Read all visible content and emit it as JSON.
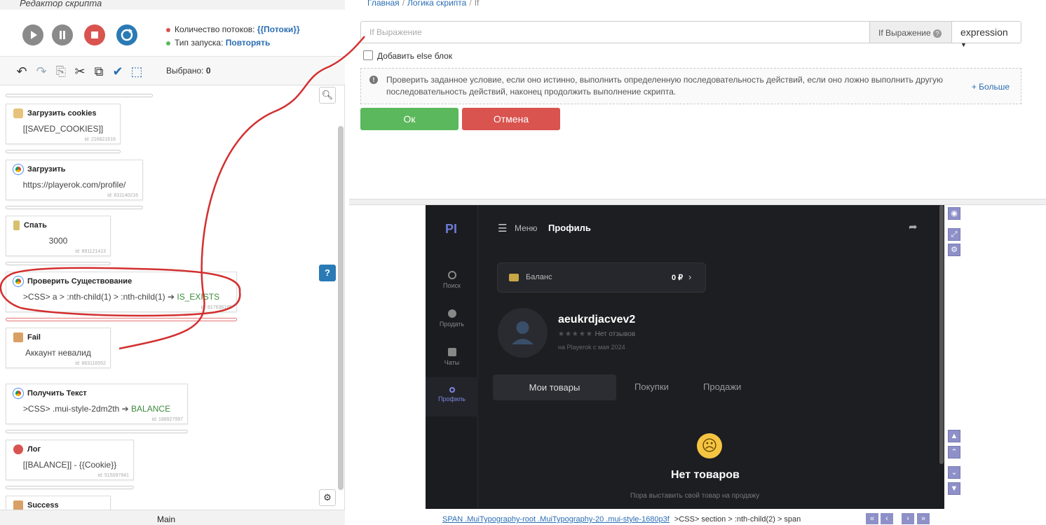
{
  "editor": {
    "title": "Редактор скрипта",
    "threads_label": "Количество потоков:",
    "threads_value": "{{Потоки}}",
    "launch_label": "Тип запуска:",
    "launch_value": "Повторять",
    "selected_label": "Выбрано:",
    "selected_value": "0",
    "footer_tab": "Main",
    "colors": {
      "play": "#8a8a8a",
      "pause": "#8a8a8a",
      "stop": "#d9534f",
      "refresh": "#2a7ab5",
      "dot_red": "#d9534f",
      "dot_green": "#5cb85c"
    }
  },
  "blocks": [
    {
      "title": "Загрузить cookies",
      "value": "[[SAVED_COOKIES]]",
      "id": "id: 216821616",
      "icon": "cookie-icon"
    },
    {
      "title": "Загрузить",
      "value": "https://playerok.com/profile/",
      "id": "id: 631140216",
      "icon": "chrome-icon"
    },
    {
      "title": "Спать",
      "value": "3000",
      "id": "id: 891121413",
      "icon": "hourglass-icon"
    },
    {
      "title": "Проверить Существование",
      "value": ">CSS> a > :nth-child(1) > :nth-child(1)",
      "value_var": "IS_EXISTS",
      "id": "id: 817636185",
      "icon": "chrome-icon"
    },
    {
      "title": "Fail",
      "value": "Аккаунт невалид",
      "id": "id: 863116552",
      "icon": "fail-icon"
    },
    {
      "title": "Получить Текст",
      "value": ">CSS> .mui-style-2dm2th",
      "value_var": "BALANCE",
      "id": "id: 188927997",
      "icon": "chrome-icon"
    },
    {
      "title": "Лог",
      "value": "[[BALANCE]] - {{Cookie}}",
      "id": "id: 515097941",
      "icon": "log-icon"
    },
    {
      "title": "Success",
      "value": "",
      "id": "",
      "icon": "success-icon"
    }
  ],
  "breadcrumb": {
    "home": "Главная",
    "logic": "Логика скрипта",
    "current": "If"
  },
  "form": {
    "expression_placeholder": "If Выражение",
    "expression_label": "If Выражение",
    "expression_type": "expression",
    "else_label": "Добавить else блок",
    "else_checked": false,
    "description": "Проверить заданное условие, если оно истинно, выполнить определенную последовательность действий, если оно ложно выполнить другую последовательность действий, наконец продолжить выполнение скрипта.",
    "more_label": "+ Больше",
    "ok_label": "Ок",
    "cancel_label": "Отмена",
    "colors": {
      "ok": "#5cb85c",
      "cancel": "#d9534f"
    }
  },
  "browser": {
    "logo": "PI",
    "menu_label": "Меню",
    "page_title": "Профиль",
    "nav": [
      "Поиск",
      "Продать",
      "Чаты",
      "Профиль"
    ],
    "balance_label": "Баланс",
    "balance_value": "0 ₽",
    "username": "aeukrdjacvev2",
    "reviews": "Нет отзывов",
    "since": "на Playerok с мая 2024",
    "tabs": [
      "Мои товары",
      "Покупки",
      "Продажи"
    ],
    "empty_title": "Нет товаров",
    "empty_sub": "Пора выставить свой товар на продажу"
  },
  "status": {
    "selector_link": "SPAN .MuiTypography-root .MuiTypography-20 .mui-style-1680p3f",
    "selector_path": ">CSS> section > :nth-child(2) > span"
  },
  "annotation_color": "#d32f2f"
}
